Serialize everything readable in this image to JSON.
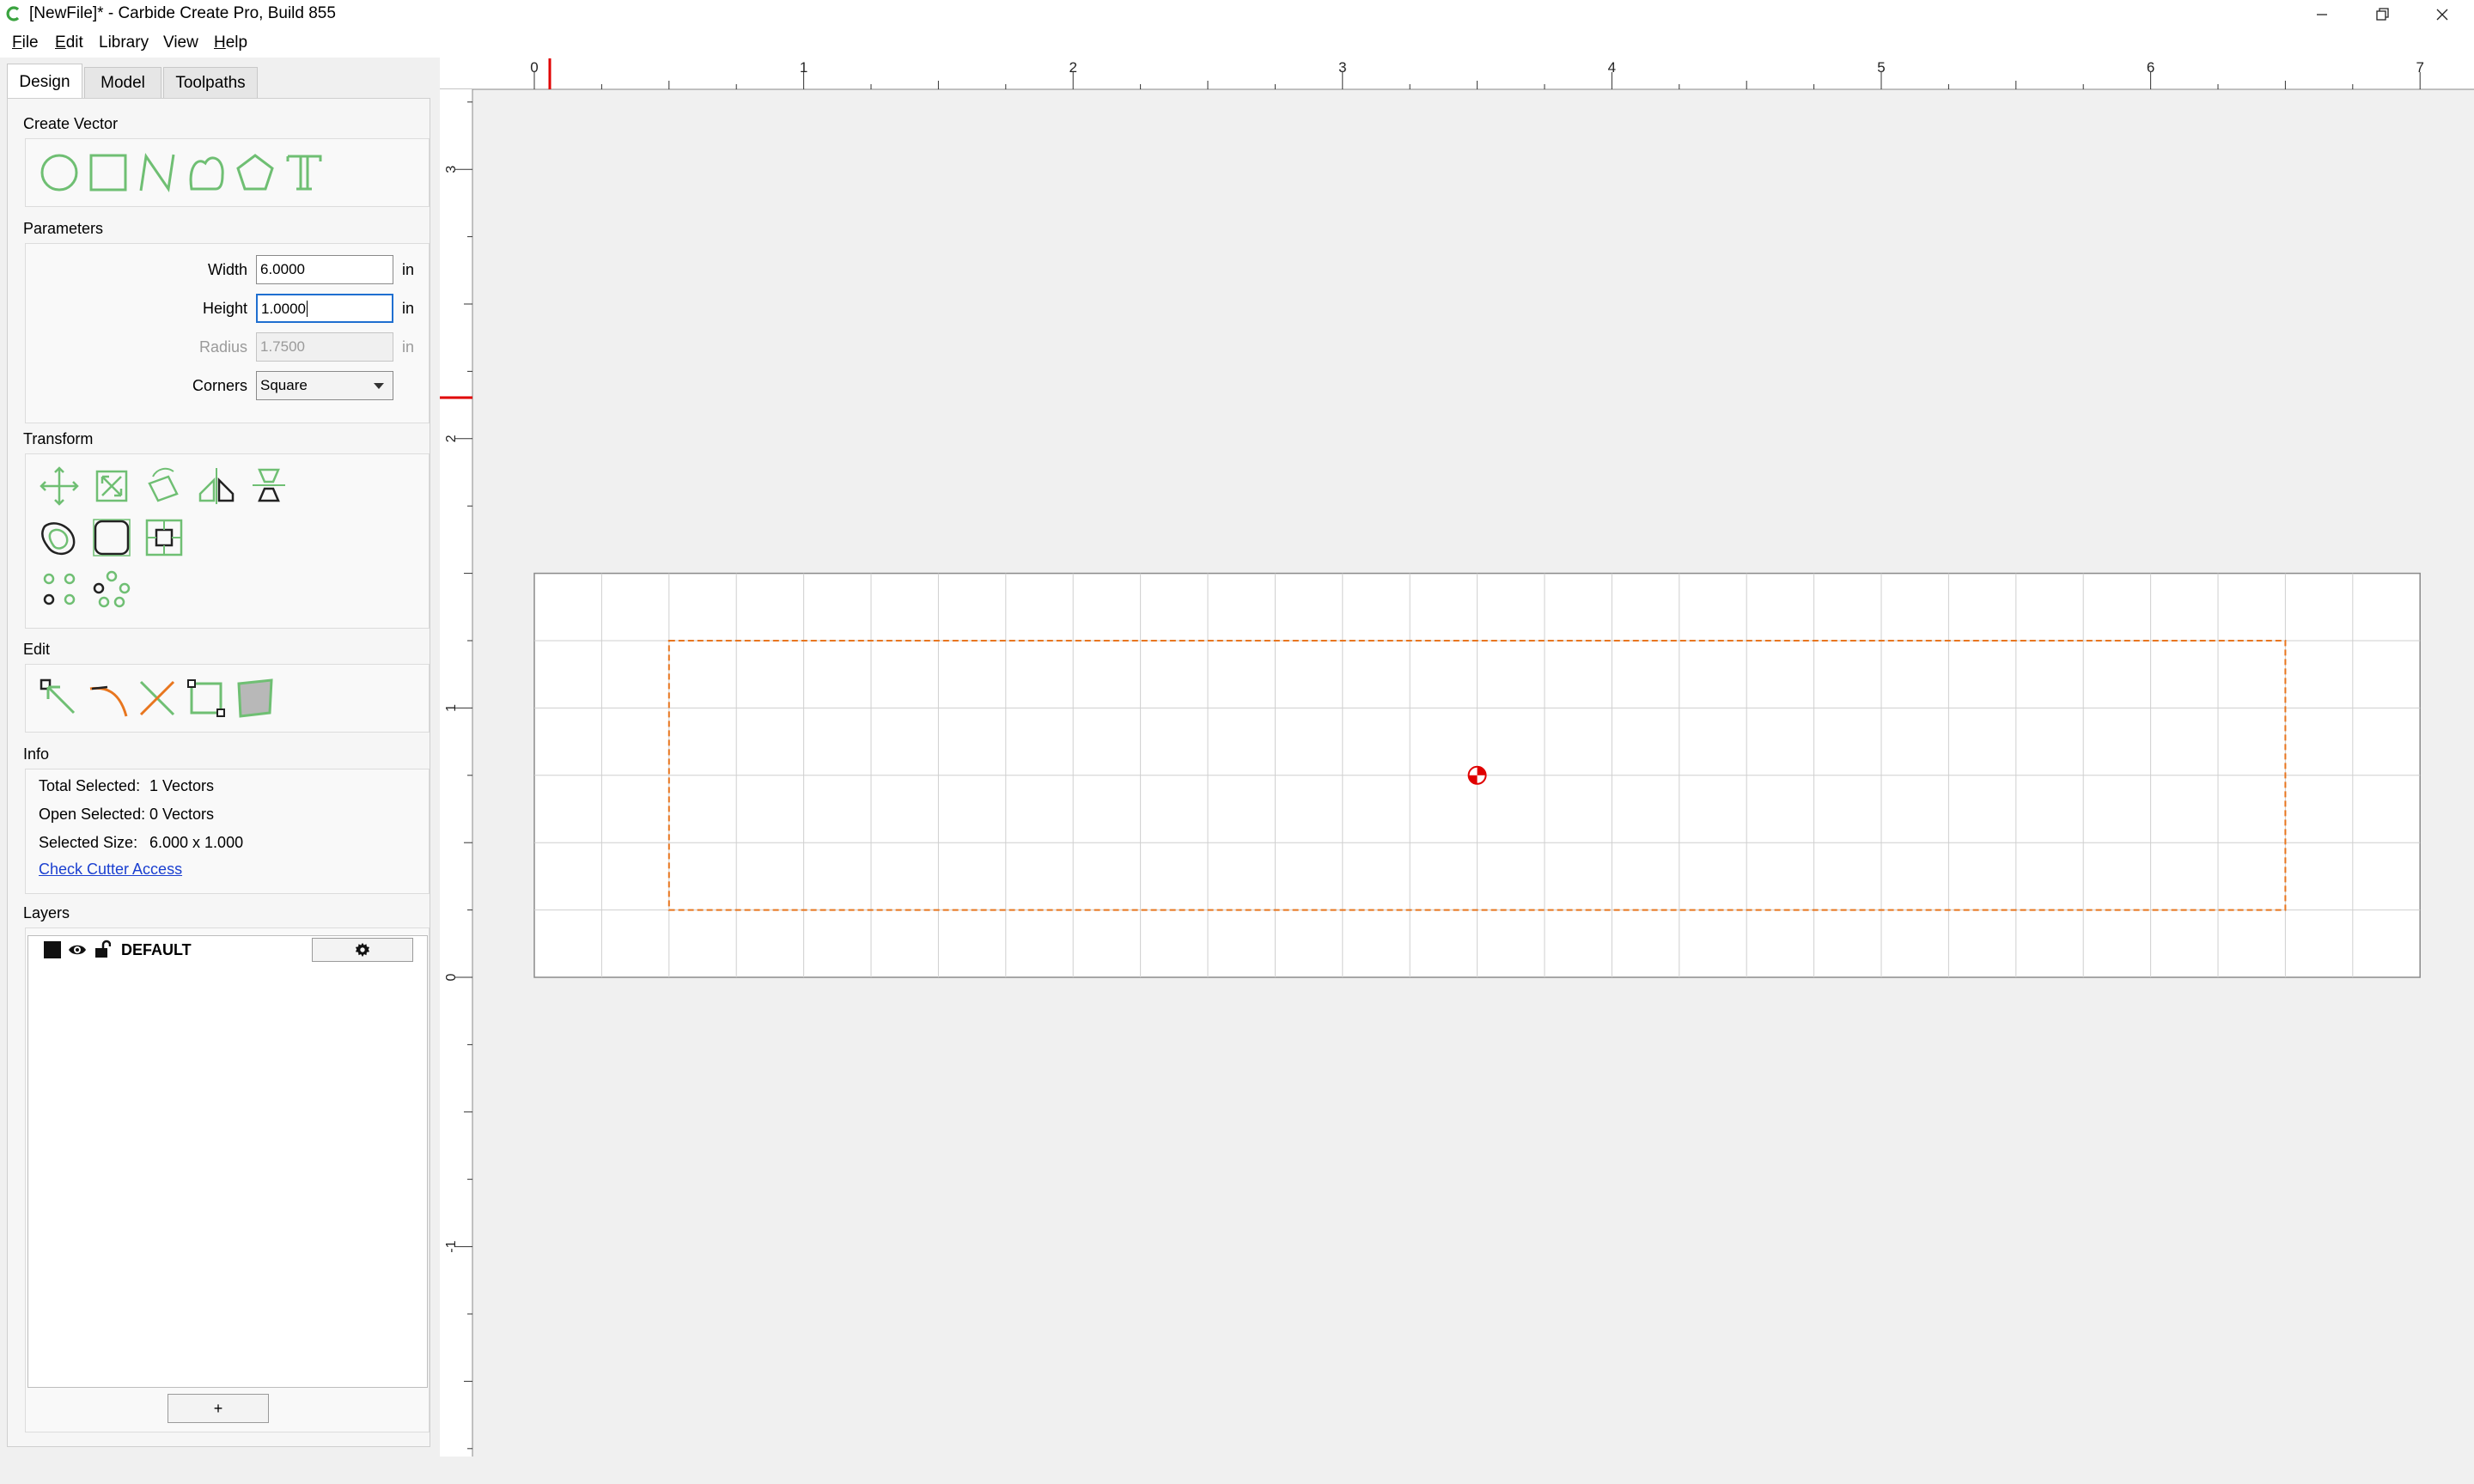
{
  "window": {
    "title": "[NewFile]* - Carbide Create Pro, Build 855"
  },
  "menu": [
    {
      "key": "F",
      "rest": "ile"
    },
    {
      "key": "E",
      "rest": "dit"
    },
    {
      "key": "",
      "rest": "Library"
    },
    {
      "key": "",
      "rest": "View"
    },
    {
      "key": "H",
      "rest": "elp"
    }
  ],
  "tabs": [
    "Design",
    "Model",
    "Toolpaths"
  ],
  "sections": {
    "create_vector": "Create Vector",
    "parameters": "Parameters",
    "transform": "Transform",
    "edit": "Edit",
    "info": "Info",
    "layers": "Layers"
  },
  "create_vector_tools": [
    "circle-icon",
    "rectangle-icon",
    "polyline-icon",
    "curve-icon",
    "polygon-icon",
    "text-icon"
  ],
  "parameters": {
    "width": {
      "label": "Width",
      "value": "6.0000",
      "unit": "in"
    },
    "height": {
      "label": "Height",
      "value": "1.0000",
      "unit": "in"
    },
    "radius": {
      "label": "Radius",
      "value": "1.7500",
      "unit": "in"
    },
    "corners": {
      "label": "Corners",
      "value": "Square"
    }
  },
  "transform_tools": [
    "move-icon",
    "scale-icon",
    "rotate-icon",
    "mirror-icon",
    "align-icon",
    "offset-icon",
    "fillet-icon",
    "boolean-icon",
    "array-icon",
    "circular-array-icon"
  ],
  "edit_tools": [
    "node-edit-icon",
    "smooth-icon",
    "trim-icon",
    "join-icon",
    "close-vector-icon"
  ],
  "info": {
    "total_selected_label": "Total Selected:",
    "total_selected_value": "1 Vectors",
    "open_selected_label": "Open Selected:",
    "open_selected_value": "0 Vectors",
    "selected_size_label": "Selected Size:",
    "selected_size_value": "6.000 x 1.000",
    "check_cutter_access": "Check Cutter Access"
  },
  "layers": {
    "items": [
      {
        "name": "DEFAULT",
        "color": "#111111",
        "visible": true,
        "locked": false
      }
    ],
    "add_label": "+"
  },
  "ruler": {
    "horizontal_labels": [
      "0",
      "1",
      "2",
      "3",
      "4",
      "5",
      "6",
      "7"
    ],
    "vertical_labels": [
      "3",
      "2",
      "1",
      "0",
      "-1"
    ]
  },
  "stock": {
    "width_in": 7,
    "height_in": 1.5
  },
  "selection": {
    "x_in": 0.5,
    "y_in": 0.25,
    "width_in": 6,
    "height_in": 1,
    "color": "#e8761f"
  },
  "colors": {
    "accent_green": "#6fbf73",
    "origin_red": "#e00000",
    "link_blue": "#1a3fd0"
  }
}
